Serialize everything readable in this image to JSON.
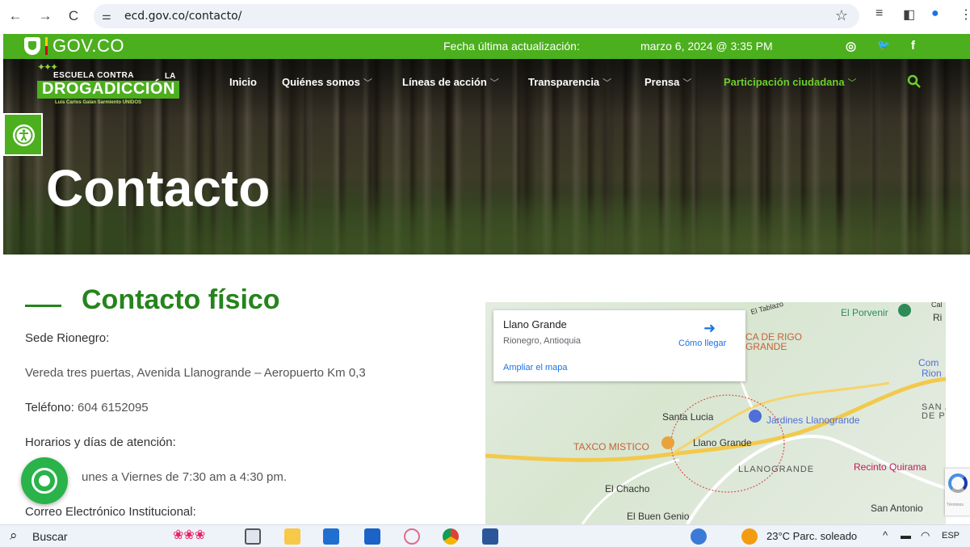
{
  "browser": {
    "url": "ecd.gov.co/contacto/",
    "back": "←",
    "forward": "→",
    "reload": "C",
    "tune": "⚌",
    "star": "☆"
  },
  "govbar": {
    "brand": "GOV.CO",
    "update_label": "Fecha última actualización:",
    "update_date": "marzo 6, 2024 @ 3:35 PM",
    "social": [
      "instagram-icon",
      "twitter-icon",
      "facebook-icon"
    ],
    "social_glyphs": [
      "◎",
      "🐦",
      "f"
    ]
  },
  "logo": {
    "top": "ESCUELA CONTRA",
    "la": "LA",
    "main": "DROGADICCIÓN",
    "sub": "Luis Carlos Galán Sarmiento  UNIDOS"
  },
  "nav": {
    "items": [
      {
        "label": "Inicio",
        "dropdown": false
      },
      {
        "label": "Quiénes somos",
        "dropdown": true
      },
      {
        "label": "Líneas de acción",
        "dropdown": true
      },
      {
        "label": "Transparencia",
        "dropdown": true
      },
      {
        "label": "Prensa",
        "dropdown": true
      },
      {
        "label": "Participación ciudadana",
        "dropdown": true,
        "active": true
      }
    ],
    "chevron": "﹀"
  },
  "hero": {
    "title": "Contacto"
  },
  "contact": {
    "section_title": "Contacto físico",
    "sede": "Sede Rionegro:",
    "address": "Vereda tres puertas, Avenida Llanogrande – Aeropuerto Km 0,3",
    "phone_label": "Teléfono:",
    "phone": " 604 6152095",
    "hours_label": "Horarios y días de atención:",
    "hours": "unes a Viernes de 7:30 am a 4:30 pm.",
    "email_label": "Correo Electrónico Institucional:"
  },
  "map": {
    "place": "Llano Grande",
    "region": "Rionegro, Antioquia",
    "directions": "Cómo llegar",
    "enlarge": "Ampliar el mapa",
    "labels": [
      "El Porvenir",
      "Ri",
      "Cal",
      "CA DE RIGO",
      "GRANDE",
      "Com",
      "Rion",
      "SAN A",
      "DE PE",
      "Santa Lucia",
      "Jardines Llanogrande",
      "TAXCO MISTICO",
      "Llano Grande",
      "LLANOGRANDE",
      "Recinto Quirama",
      "El Chacho",
      "El Buen Genio",
      "San Antonio",
      "El Tablazo"
    ]
  },
  "recaptcha": {
    "terms": "Términos"
  },
  "taskbar": {
    "search": "Buscar",
    "weather": "23°C  Parc. soleado",
    "lang": "ESP"
  },
  "colors": {
    "brand_green": "#4caf1e",
    "title_green": "#25841c",
    "whatsapp": "#29b34a",
    "link_blue": "#1a73e8"
  }
}
